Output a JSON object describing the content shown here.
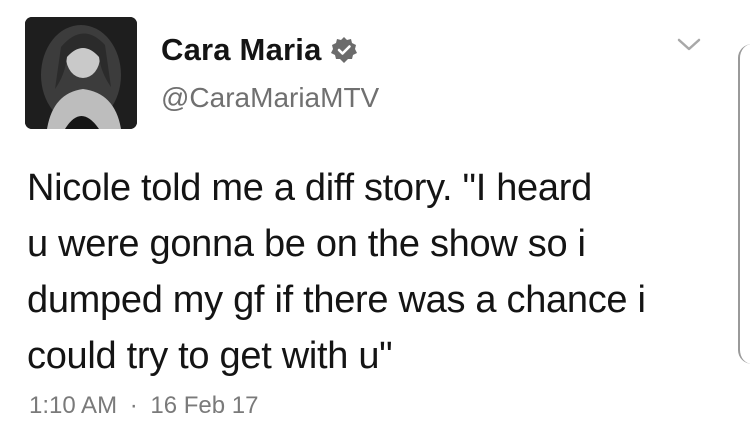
{
  "tweet": {
    "display_name": "Cara Maria",
    "handle": "@CaraMariaMTV",
    "text": "Nicole told me a diff story. \"I heard\nu were gonna be on the show so i\ndumped my gf if there was a chance i\ncould try to get with u\"",
    "time": "1:10 AM",
    "separator": "·",
    "date": "16 Feb 17",
    "verified_icon": "verified-badge-icon",
    "menu_icon": "chevron-down-icon"
  }
}
